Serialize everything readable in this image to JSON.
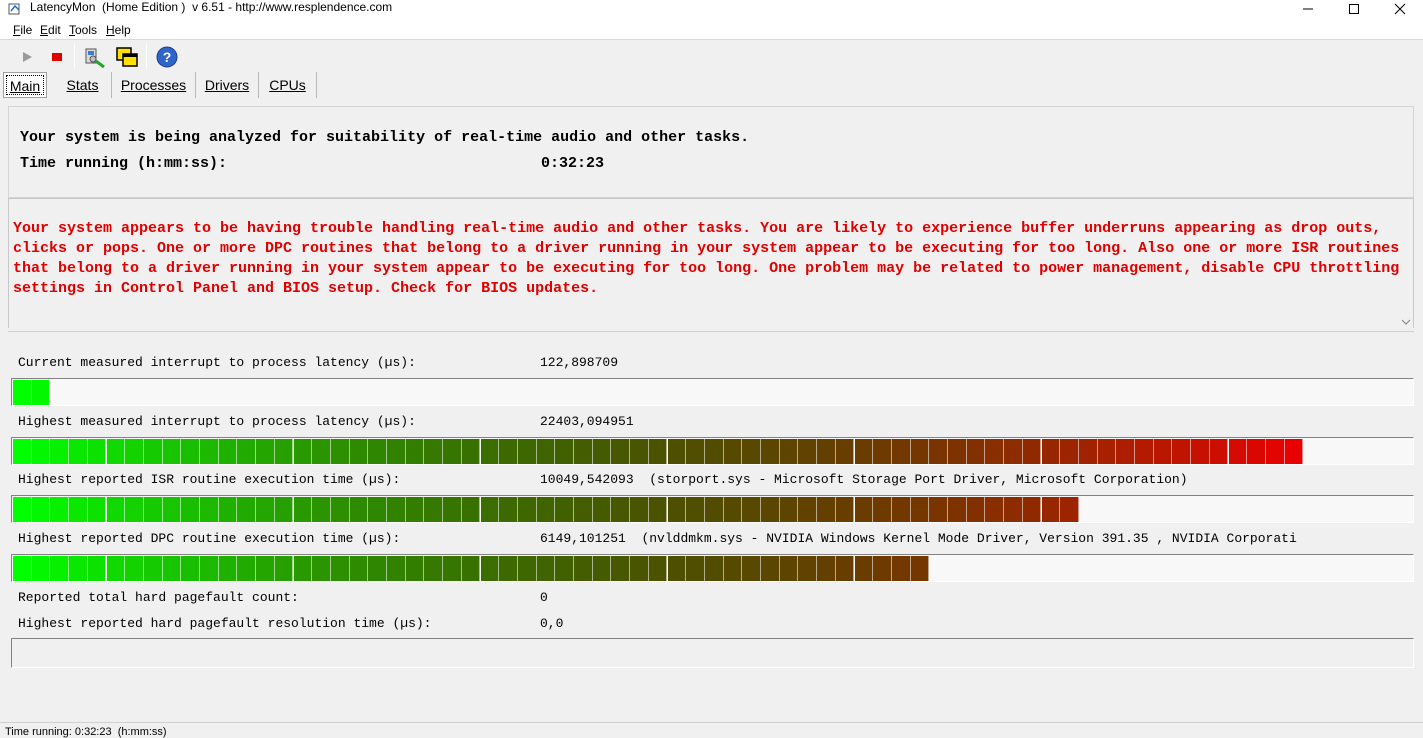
{
  "window": {
    "title": "LatencyMon  (Home Edition )  v 6.51 - http://www.resplendence.com"
  },
  "menu": [
    {
      "label": "File",
      "key": "F",
      "rest": "ile"
    },
    {
      "label": "Edit",
      "key": "E",
      "rest": "dit"
    },
    {
      "label": "Tools",
      "key": "T",
      "rest": "ools"
    },
    {
      "label": "Help",
      "key": "H",
      "rest": "elp"
    }
  ],
  "toolbar": {
    "icons": [
      "play-icon",
      "stop-icon",
      "driver-icon",
      "windows-icon",
      "help-icon"
    ]
  },
  "tabs": [
    {
      "label": "Main",
      "active": true
    },
    {
      "label": "Stats",
      "active": false
    },
    {
      "label": "Processes",
      "active": false
    },
    {
      "label": "Drivers",
      "active": false
    },
    {
      "label": "CPUs",
      "active": false
    }
  ],
  "summary": {
    "line1": "Your system is being analyzed for suitability of real-time audio and other tasks.",
    "time_label": "Time running (h:mm:ss):",
    "time_value": "0:32:23"
  },
  "warning": "Your system appears to be having trouble handling real-time audio and other tasks. You are likely to experience buffer underruns appearing as drop outs, clicks or pops. One or more DPC routines that belong to a driver running in your system appear to be executing for too long. Also one or more ISR routines that belong to a driver running in your system appear to be executing for too long. One problem may be related to power management, disable CPU throttling settings in Control Panel and BIOS setup. Check for BIOS updates.",
  "stats": {
    "current_latency": {
      "label": "Current measured interrupt to process latency (µs):",
      "value": "122,898709",
      "level": 0.029
    },
    "highest_latency": {
      "label": "Highest measured interrupt to process latency (µs):",
      "value": "22403,094951",
      "level": 0.928
    },
    "isr": {
      "label": "Highest reported ISR routine execution time (µs):",
      "value": "10049,542093",
      "detail": "(storport.sys - Microsoft Storage Port Driver, Microsoft Corporation)",
      "level": 0.768
    },
    "dpc": {
      "label": "Highest reported DPC routine execution time (µs):",
      "value": "6149,101251",
      "detail": "(nvlddmkm.sys - NVIDIA Windows Kernel Mode Driver, Version 391.35 , NVIDIA Corporati",
      "level": 0.658
    },
    "pagefault_count": {
      "label": "Reported total hard pagefault count:",
      "value": "0"
    },
    "pagefault_time": {
      "label": "Highest reported hard pagefault resolution time (µs):",
      "value": "0,0",
      "level": 0
    }
  },
  "status_bar": "Time running: 0:32:23  (h:mm:ss)",
  "colors": {
    "warning": "#e00000",
    "bar_start": "#00ff00",
    "bar_end": "#e80000"
  }
}
